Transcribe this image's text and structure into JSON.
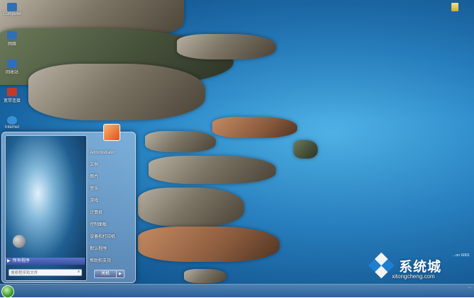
{
  "desktop": {
    "icons": [
      {
        "label": "Computer",
        "color": "#2f6fb8"
      },
      {
        "label": "网络",
        "color": "#2f6fb8"
      },
      {
        "label": "回收站",
        "color": "#2f6fb8"
      },
      {
        "label": "宽带连接",
        "color": "#c33a2a"
      },
      {
        "label": "Internet",
        "color": "#3b8fd0"
      }
    ],
    "build_text": "...on 6001"
  },
  "start_menu": {
    "all_programs_label": "所有程序",
    "search_placeholder": "搜索程序和文件",
    "right_items": [
      "Administrator",
      "文档",
      "图片",
      "音乐",
      "游戏",
      "计算机",
      "控制面板",
      "设备和打印机",
      "默认程序",
      "帮助和支持"
    ],
    "shutdown_label": "关机"
  },
  "taskbar": {
    "clock": "...",
    "date": ""
  },
  "watermark": {
    "name": "系统城",
    "url": "xitongcheng.com"
  },
  "colors": {
    "sea": "#2a86c6",
    "accent": "#3a4fa3",
    "watermark_blue": "#1e7fd1"
  }
}
